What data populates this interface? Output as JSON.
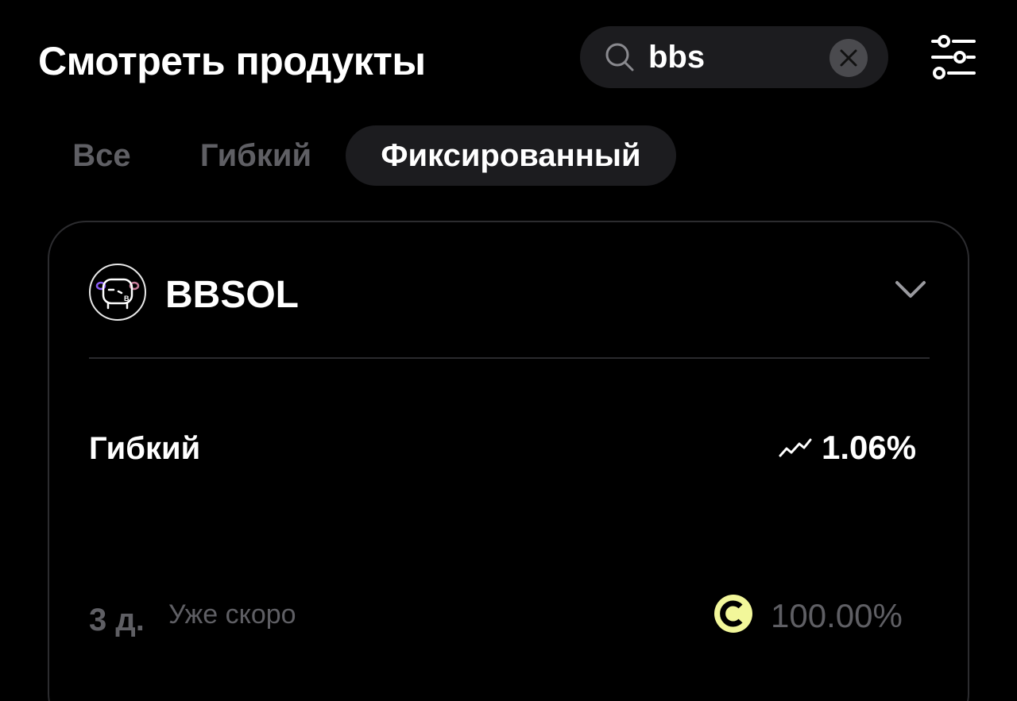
{
  "header": {
    "title": "Смотреть продукты"
  },
  "search": {
    "value": "bbs",
    "icon": "search-icon",
    "clear_icon": "close-icon"
  },
  "filter": {
    "icon": "sliders-icon"
  },
  "tabs": [
    {
      "label": "Все",
      "active": false
    },
    {
      "label": "Гибкий",
      "active": false
    },
    {
      "label": "Фиксированный",
      "active": true
    }
  ],
  "product": {
    "name": "BBSOL",
    "logo": "bbsol-token-logo",
    "logo_letter": "B",
    "expand_icon": "chevron-down-icon",
    "flexible": {
      "label": "Гибкий",
      "apr": "1.06%",
      "icon": "trend-up-icon"
    },
    "fixed": {
      "term": "3 д.",
      "status": "Уже скоро",
      "progress": "100.00%",
      "coin_icon": "coin-icon"
    }
  },
  "colors": {
    "background": "#000000",
    "surface": "#1c1c1f",
    "border": "#2c2c2f",
    "muted_text": "#5f5f64",
    "accent_coin": "#f2f79a"
  }
}
